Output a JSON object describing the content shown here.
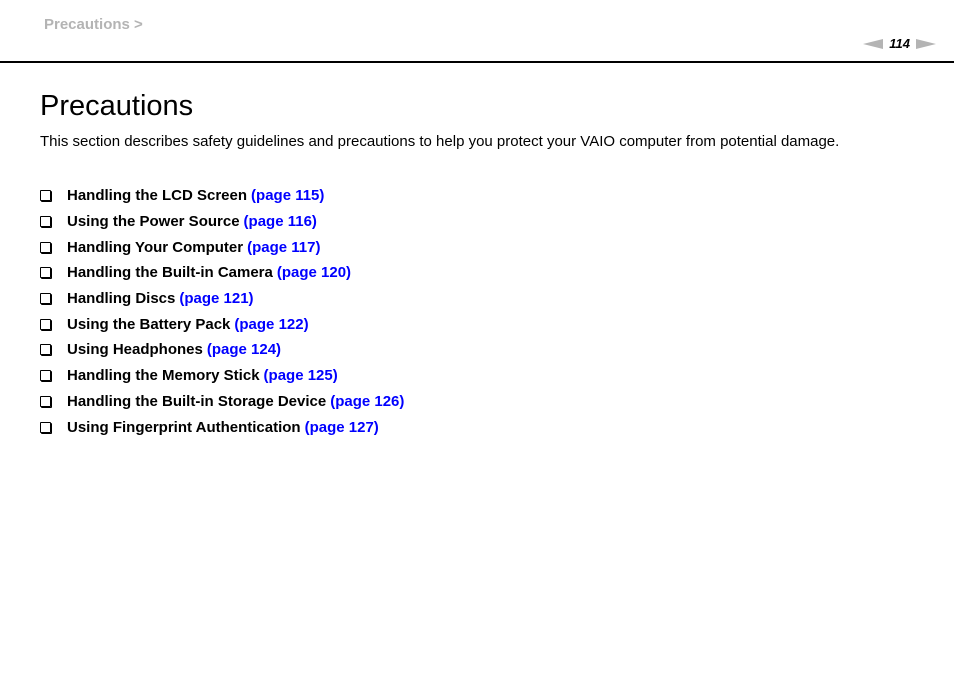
{
  "header": {
    "breadcrumb": "Precautions >",
    "page_number": "114",
    "prev_icon": "triangle-left-icon",
    "next_icon": "triangle-right-icon",
    "nav_color": "#b4b4b4"
  },
  "main": {
    "title": "Precautions",
    "intro": "This section describes safety guidelines and precautions to help you protect your VAIO computer from potential damage.",
    "link_color": "#0000ff",
    "items": [
      {
        "label": "Handling the LCD Screen",
        "link": "(page 115)"
      },
      {
        "label": "Using the Power Source",
        "link": "(page 116)"
      },
      {
        "label": "Handling Your Computer",
        "link": "(page 117)"
      },
      {
        "label": "Handling the Built-in Camera",
        "link": "(page 120)"
      },
      {
        "label": "Handling Discs",
        "link": "(page 121)"
      },
      {
        "label": "Using the Battery Pack",
        "link": "(page 122)"
      },
      {
        "label": "Using Headphones",
        "link": "(page 124)"
      },
      {
        "label": "Handling the Memory Stick",
        "link": "(page 125)"
      },
      {
        "label": "Handling the Built-in Storage Device",
        "link": "(page 126)"
      },
      {
        "label": "Using Fingerprint Authentication",
        "link": "(page 127)"
      }
    ]
  }
}
